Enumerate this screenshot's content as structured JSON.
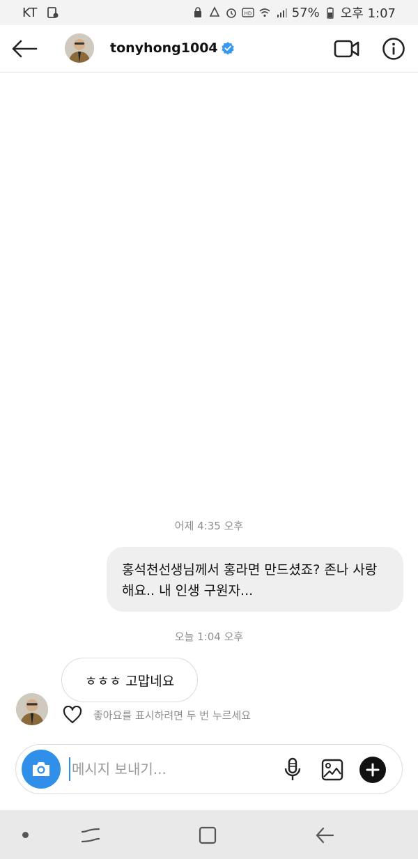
{
  "status_bar": {
    "carrier": "KT",
    "battery": "57%",
    "time": "오후 1:07"
  },
  "header": {
    "username": "tonyhong1004",
    "verified": true
  },
  "messages": [
    {
      "type": "timestamp",
      "text": "어제 4:35 오후"
    },
    {
      "type": "outgoing",
      "text": "홍석천선생님께서 홍라면 만드셨죠? 존나 사랑해요.. 내 인생 구원자..."
    },
    {
      "type": "timestamp",
      "text": "오늘 1:04 오후"
    },
    {
      "type": "incoming",
      "text": "ㅎㅎㅎ 고맙네요"
    }
  ],
  "like_hint": "좋아요를 표시하려면 두 번 누르세요",
  "composer": {
    "placeholder": "메시지 보내기..."
  },
  "colors": {
    "accent": "#2f8fe9",
    "verified_badge": "#3897f0",
    "outgoing_bubble": "#efefef",
    "muted_text": "#8e8e8e"
  },
  "icons": [
    "back-arrow-icon",
    "verified-badge-icon",
    "video-call-icon",
    "info-icon",
    "camera-icon",
    "microphone-icon",
    "gallery-icon",
    "plus-icon",
    "heart-icon"
  ]
}
